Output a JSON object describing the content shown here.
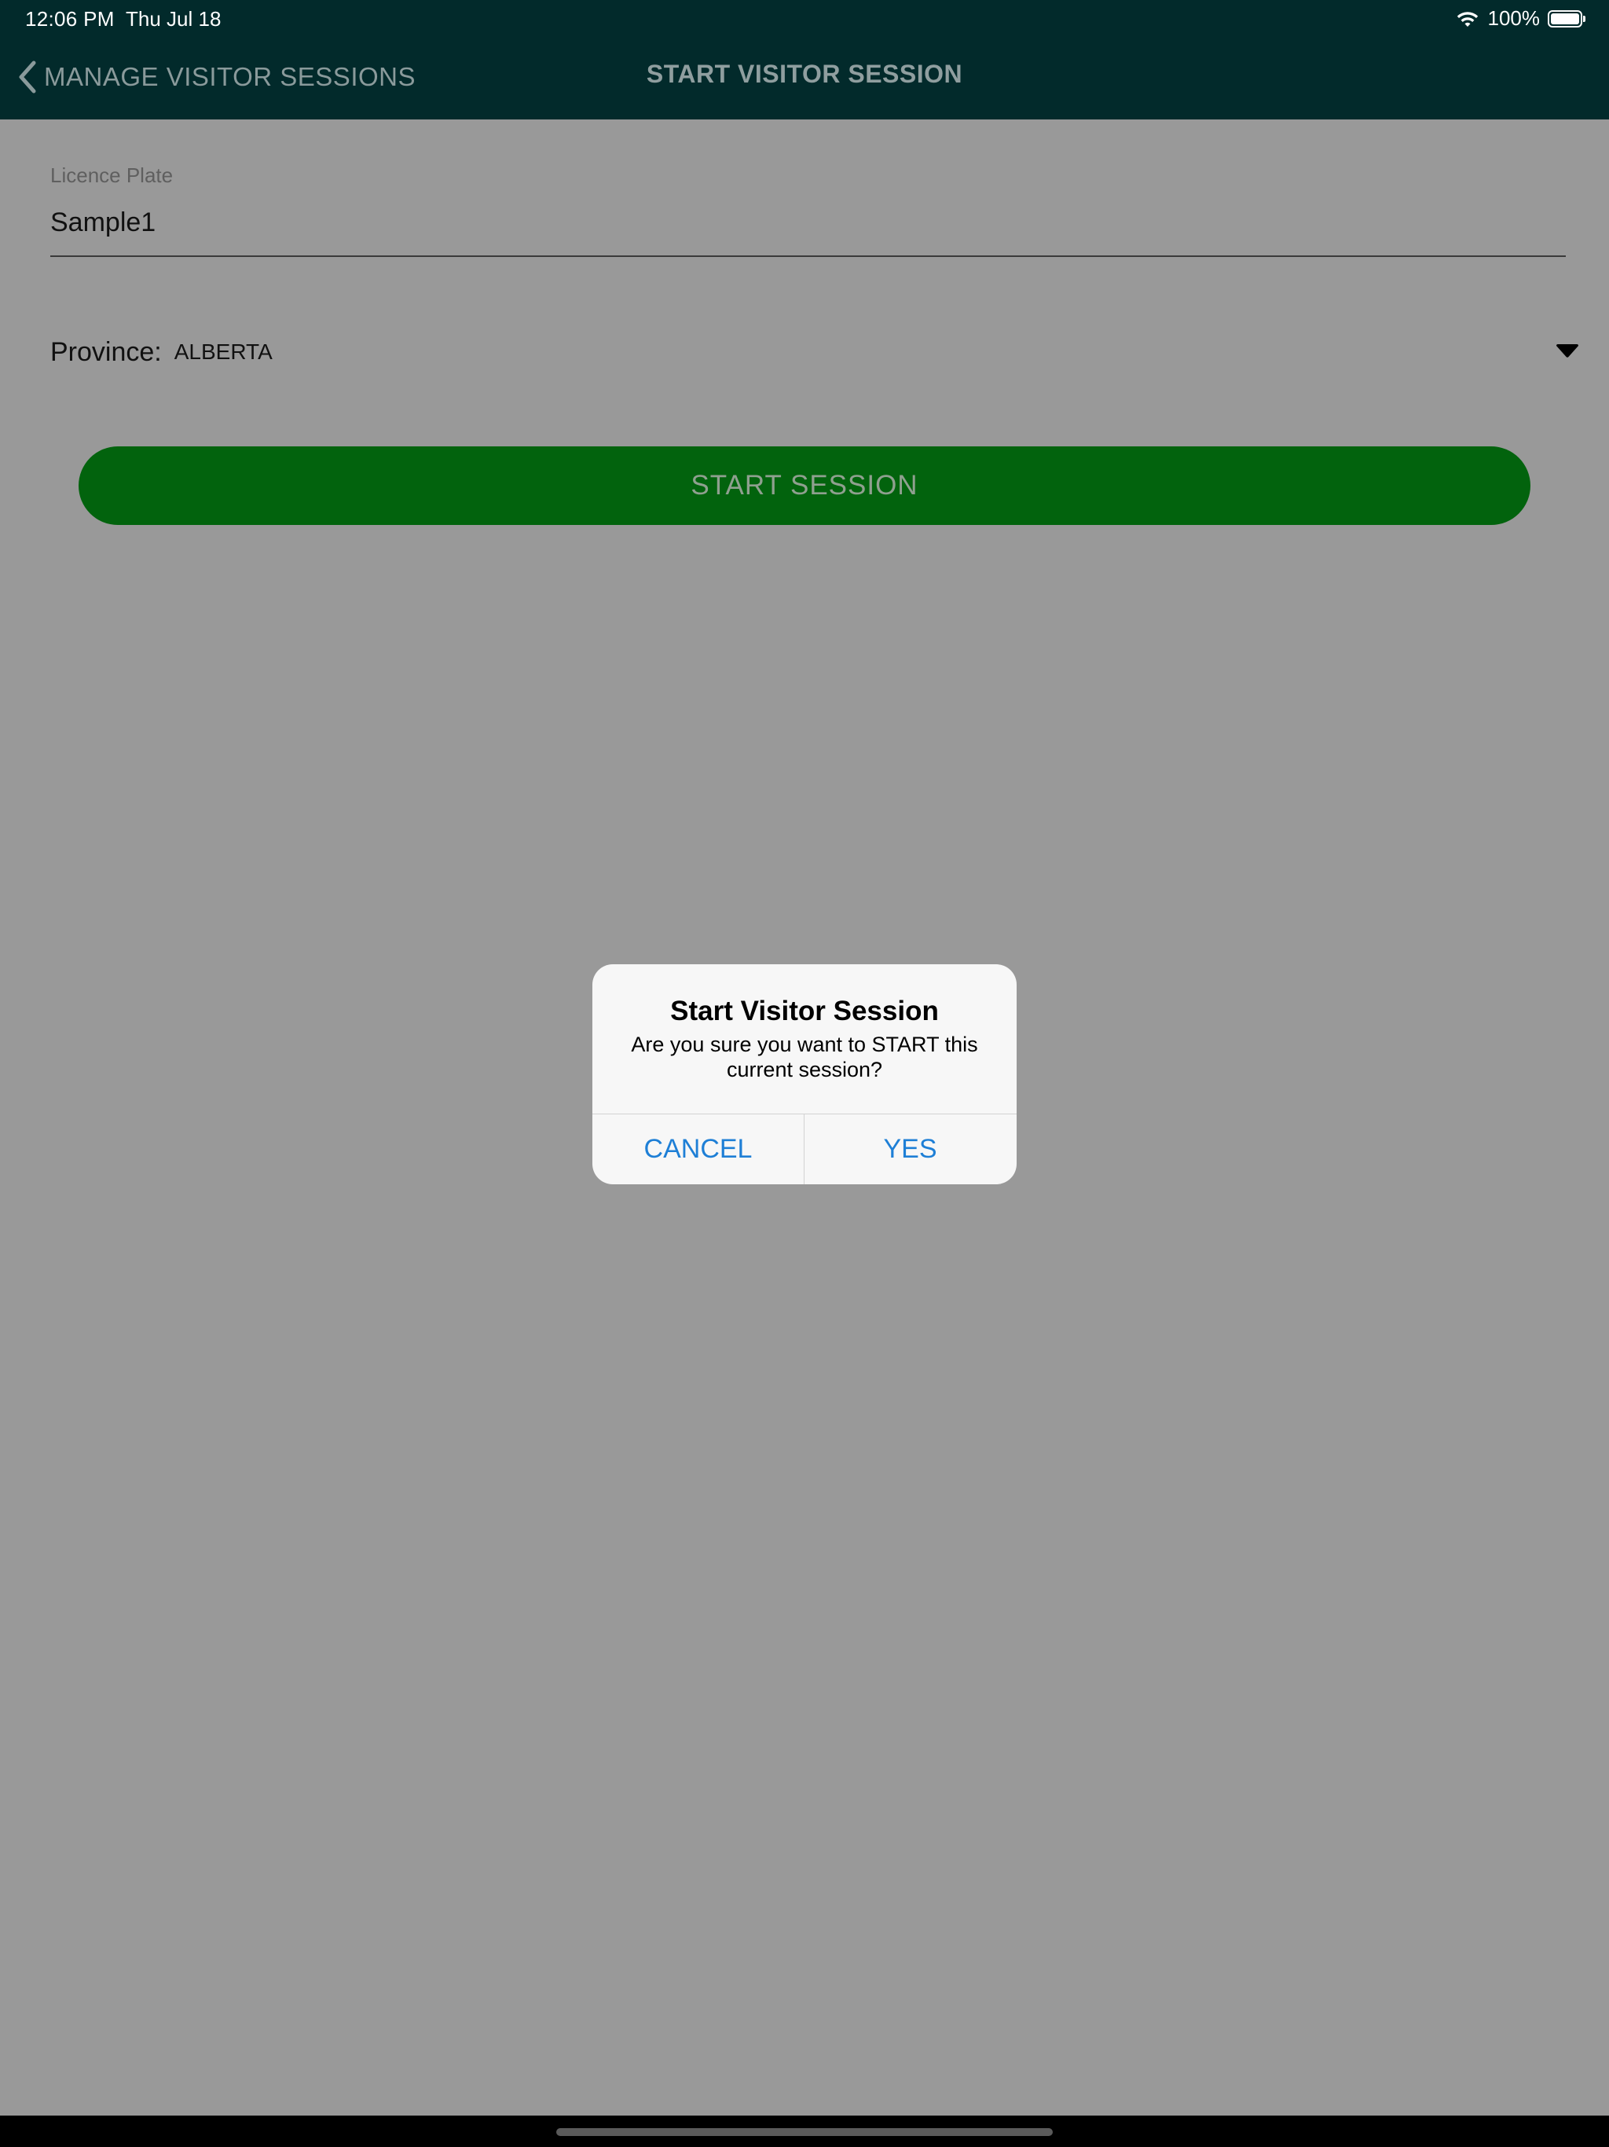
{
  "status_bar": {
    "time": "12:06 PM",
    "date": "Thu Jul 18",
    "battery_percent": "100%",
    "icons": [
      "wifi-icon",
      "battery-icon"
    ]
  },
  "nav": {
    "back_label": "MANAGE VISITOR SESSIONS",
    "back_icon": "chevron-left-icon",
    "title": "START VISITOR SESSION"
  },
  "form": {
    "plate_label": "Licence Plate",
    "plate_value": "Sample1",
    "province_label": "Province:",
    "province_value": "ALBERTA",
    "province_icon": "dropdown-arrow-icon",
    "start_button_label": "START SESSION"
  },
  "alert": {
    "title": "Start Visitor Session",
    "message": "Are you sure you want to START this current session?",
    "cancel_label": "CANCEL",
    "confirm_label": "YES"
  },
  "colors": {
    "overlay_background": "#999999",
    "top_bar": "#022a2b",
    "button_green": "#02630d",
    "alert_background": "#f7f7f7",
    "alert_action": "#1e7fd6"
  }
}
